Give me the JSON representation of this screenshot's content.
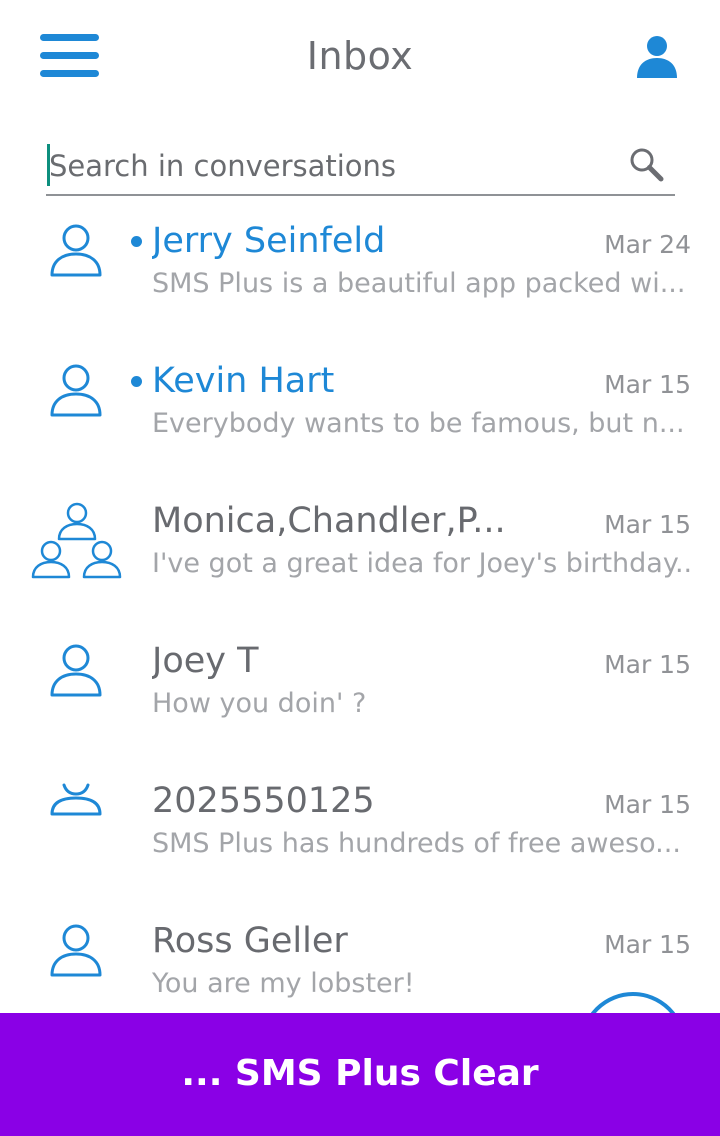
{
  "header": {
    "title": "Inbox",
    "menu_icon": "hamburger-menu-icon",
    "profile_icon": "user-profile-icon"
  },
  "search": {
    "placeholder": "Search in conversations",
    "value": "",
    "icon": "search-icon"
  },
  "conversations": [
    {
      "name": "Jerry Seinfeld",
      "date": "Mar 24",
      "preview": "SMS Plus is a beautiful app packed wi...",
      "unread": true,
      "avatar": "person-icon"
    },
    {
      "name": "Kevin Hart",
      "date": "Mar 15",
      "preview": "Everybody wants to be famous, but n...",
      "unread": true,
      "avatar": "person-icon"
    },
    {
      "name": "Monica,Chandler,P...",
      "date": "Mar 15",
      "preview": "I've got a great idea for Joey's birthday...",
      "unread": false,
      "avatar": "group-icon"
    },
    {
      "name": "Joey T",
      "date": "Mar 15",
      "preview": "How you doin' ?",
      "unread": false,
      "avatar": "person-icon"
    },
    {
      "name": "2025550125",
      "date": "Mar 15",
      "preview": "SMS Plus has hundreds of free aweso...",
      "unread": false,
      "avatar": "person-icon"
    },
    {
      "name": "Ross Geller",
      "date": "Mar 15",
      "preview": "You are my lobster!",
      "unread": false,
      "avatar": "person-icon"
    }
  ],
  "banner": {
    "text": "... SMS Plus Clear"
  },
  "colors": {
    "accent": "#1e88d6",
    "banner": "#8a00e6",
    "text": "#686a6f",
    "muted": "#a3a5a9"
  }
}
